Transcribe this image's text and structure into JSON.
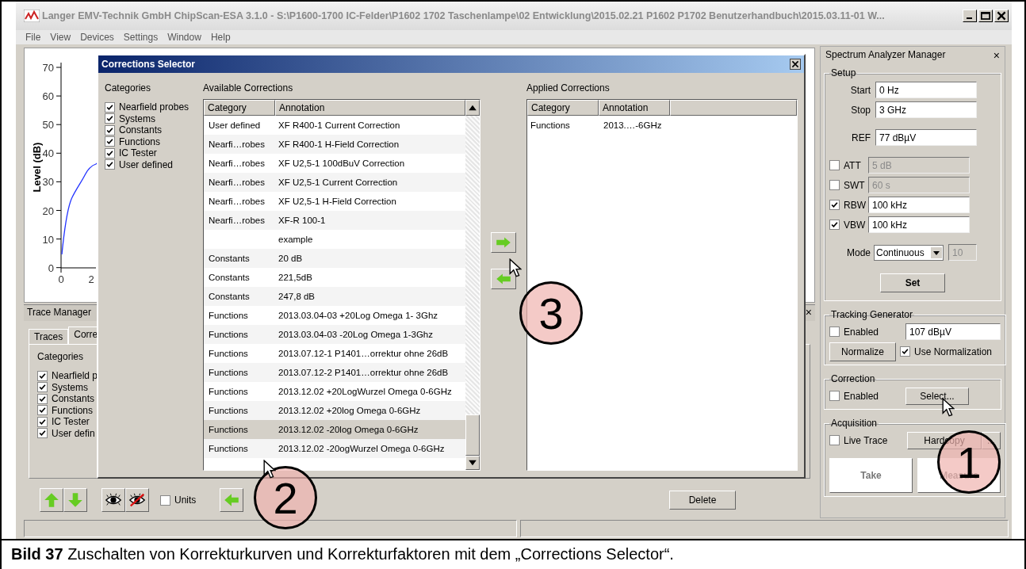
{
  "window": {
    "title": "Langer EMV-Technik GmbH ChipScan-ESA 3.1.0  -  S:\\P1600-1700 IC-Felder\\P1602 1702 Taschenlampe\\02 Entwicklung\\2015.02.21 P1602 P1702 Benutzerhandbuch\\2015.03.11-01 W..."
  },
  "menu": [
    "File",
    "View",
    "Devices",
    "Settings",
    "Window",
    "Help"
  ],
  "plot": {
    "ylabel": "Level (dB)",
    "yticks": [
      "70",
      "60",
      "50",
      "40",
      "30",
      "20",
      "10",
      "0"
    ],
    "xticks": [
      "0",
      "2"
    ]
  },
  "trace_manager": {
    "title": "Trace Manager",
    "close": "×",
    "tabs": [
      {
        "label": "Traces",
        "selected": false
      },
      {
        "label": "Corre",
        "selected": true
      }
    ],
    "categories_label": "Categories",
    "categories": [
      {
        "label": "Nearfield p",
        "checked": true
      },
      {
        "label": "Systems",
        "checked": true
      },
      {
        "label": "Constants",
        "checked": true
      },
      {
        "label": "Functions",
        "checked": true
      },
      {
        "label": "IC Tester",
        "checked": true
      },
      {
        "label": "User defin",
        "checked": true
      }
    ]
  },
  "toolbar": {
    "units": {
      "label": "Units",
      "checked": false
    },
    "delete": "Delete"
  },
  "spectrum_manager": {
    "title": "Spectrum Analyzer Manager",
    "close": "×",
    "setup": {
      "title": "Setup",
      "fields": [
        {
          "kind": "plain",
          "label": "Start",
          "value": "0 Hz"
        },
        {
          "kind": "plain",
          "label": "Stop",
          "value": "3 GHz"
        },
        {
          "kind": "plain",
          "label": "REF",
          "value": "77 dBµV"
        },
        {
          "kind": "check",
          "label": "ATT",
          "checked": false,
          "value": "5 dB"
        },
        {
          "kind": "check",
          "label": "SWT",
          "checked": false,
          "value": "60 s"
        },
        {
          "kind": "check",
          "label": "RBW",
          "checked": true,
          "value": "100 kHz"
        },
        {
          "kind": "check",
          "label": "VBW",
          "checked": true,
          "value": "100 kHz"
        }
      ],
      "mode": {
        "label": "Mode",
        "value": "Continuous",
        "count": "10"
      },
      "set": "Set"
    },
    "tracking": {
      "title": "Tracking Generator",
      "enabled": {
        "label": "Enabled",
        "checked": false
      },
      "value": "107 dBµV",
      "normalize": "Normalize",
      "use_normalization": {
        "label": "Use Normalization",
        "checked": true
      }
    },
    "correction": {
      "title": "Correction",
      "enabled": {
        "label": "Enabled",
        "checked": false
      },
      "select": "Select..."
    },
    "acquisition": {
      "title": "Acquisition",
      "live_trace": {
        "label": "Live Trace",
        "checked": false
      },
      "hardcopy": "Hardcopy",
      "more": "...",
      "take": "Take",
      "measure": "Measure"
    }
  },
  "dialog": {
    "title": "Corrections Selector",
    "categories_label": "Categories",
    "categories": [
      {
        "label": "Nearfield probes",
        "checked": true
      },
      {
        "label": "Systems",
        "checked": true
      },
      {
        "label": "Constants",
        "checked": true
      },
      {
        "label": "Functions",
        "checked": true
      },
      {
        "label": "IC Tester",
        "checked": true
      },
      {
        "label": "User defined",
        "checked": true
      }
    ],
    "available": {
      "label": "Available Corrections",
      "columns": [
        "Category",
        "Annotation"
      ],
      "rows": [
        {
          "category": "User defined",
          "annotation": "XF R400-1 Current Correction",
          "selected": false
        },
        {
          "category": "Nearfi…robes",
          "annotation": "XF R400-1 H-Field Correction",
          "selected": false
        },
        {
          "category": "Nearfi…robes",
          "annotation": "XF U2,5-1 100dBuV Correction",
          "selected": false
        },
        {
          "category": "Nearfi…robes",
          "annotation": "XF U2,5-1 Current Correction",
          "selected": false
        },
        {
          "category": "Nearfi…robes",
          "annotation": "XF U2,5-1 H-Field Correction",
          "selected": false
        },
        {
          "category": "Nearfi…robes",
          "annotation": "XF-R 100-1",
          "selected": false
        },
        {
          "category": "",
          "annotation": "example",
          "selected": false
        },
        {
          "category": "Constants",
          "annotation": "20 dB",
          "selected": false
        },
        {
          "category": "Constants",
          "annotation": "221,5dB",
          "selected": false
        },
        {
          "category": "Constants",
          "annotation": "247,8 dB",
          "selected": false
        },
        {
          "category": "Functions",
          "annotation": "2013.03.04-03 +20Log Omega 1- 3Ghz",
          "selected": false
        },
        {
          "category": "Functions",
          "annotation": "2013.03.04-03 -20Log Omega 1-3Ghz",
          "selected": false
        },
        {
          "category": "Functions",
          "annotation": "2013.07.12-1 P1401…orrektur ohne 26dB",
          "selected": false
        },
        {
          "category": "Functions",
          "annotation": "2013.07.12-2 P1401…orrektur ohne 26dB",
          "selected": false
        },
        {
          "category": "Functions",
          "annotation": "2013.12.02 +20LogWurzel Omega 0-6GHz",
          "selected": false
        },
        {
          "category": "Functions",
          "annotation": "2013.12.02 +20log Omega 0-6GHz",
          "selected": false
        },
        {
          "category": "Functions",
          "annotation": "2013.12.02 -20log Omega 0-6GHz",
          "selected": true
        },
        {
          "category": "Functions",
          "annotation": "2013.12.02 -20ogWurzel Omega 0-6GHz",
          "selected": false
        }
      ]
    },
    "applied": {
      "label": "Applied Corrections",
      "columns": [
        "Category",
        "Annotation"
      ],
      "rows": [
        {
          "category": "Functions",
          "annotation": "2013.…-6GHz",
          "selected": false
        }
      ]
    }
  },
  "callouts": [
    "1",
    "2",
    "3"
  ],
  "caption": "**Bild 37**  Zuschalten von Korrekturkurven und Korrekturfaktoren mit dem „Corrections Selector“."
}
